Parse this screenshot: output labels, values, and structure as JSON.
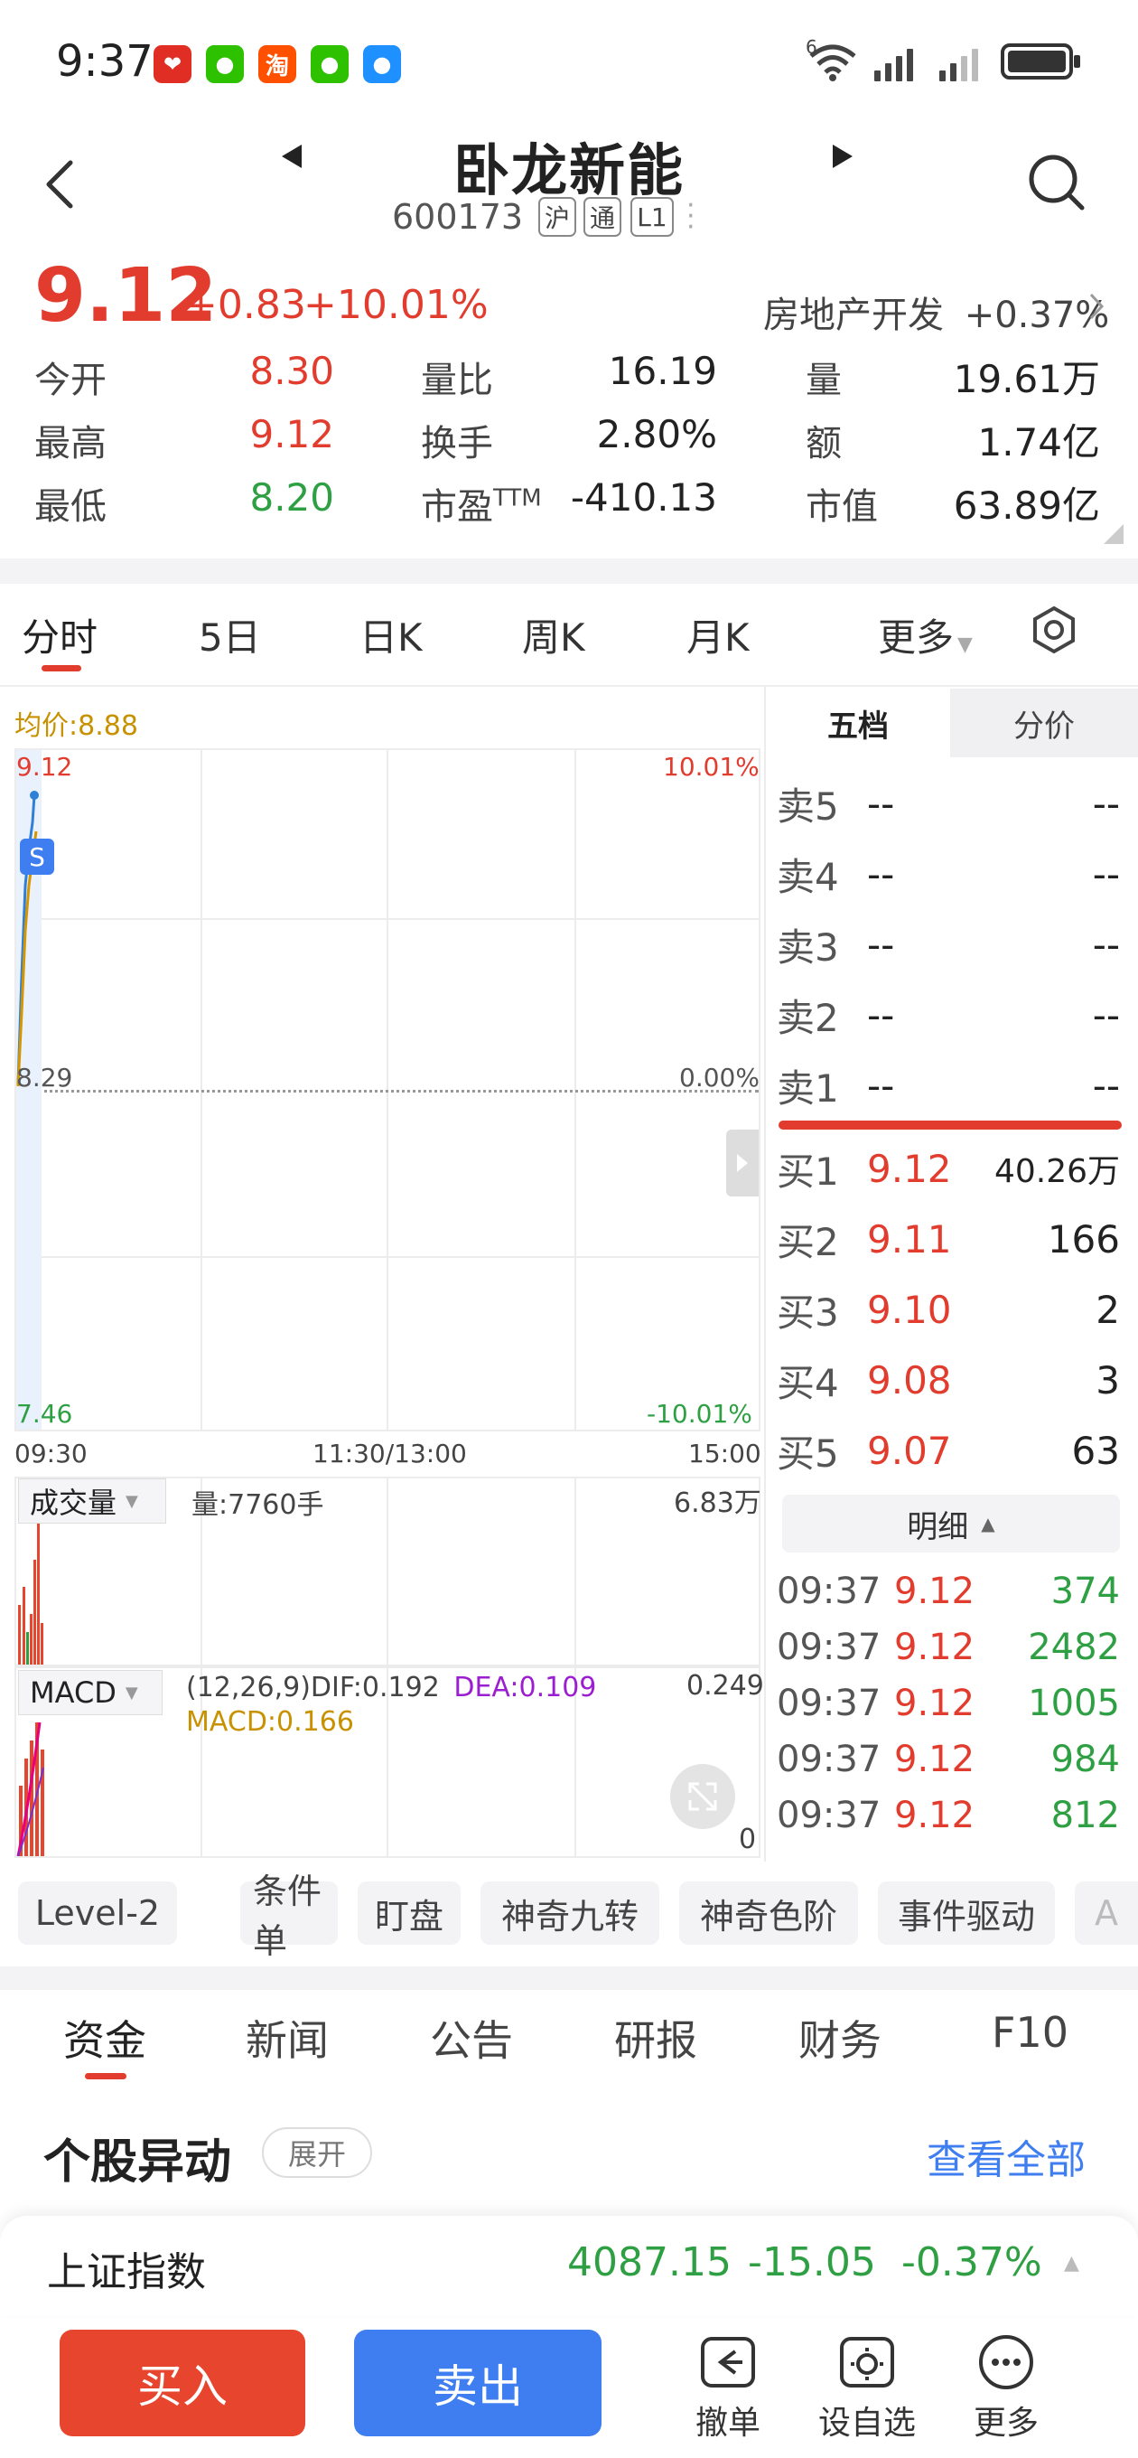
{
  "status_bar": {
    "time": "9:37",
    "apps": [
      {
        "name": "pinduoduo-icon",
        "color": "#e02e24",
        "glyph": "❤"
      },
      {
        "name": "wechat-icon",
        "color": "#2dc100",
        "glyph": "●"
      },
      {
        "name": "taobao-icon",
        "color": "#ff5000",
        "glyph": "淘"
      },
      {
        "name": "wechat-icon-2",
        "color": "#2dc100",
        "glyph": "●"
      },
      {
        "name": "messages-icon",
        "color": "#1e90ff",
        "glyph": "●"
      }
    ],
    "network": "6"
  },
  "header": {
    "title": "卧龙新能",
    "code": "600173",
    "tags": [
      "沪",
      "通",
      "L1"
    ]
  },
  "quote": {
    "price": "9.12",
    "change": "+0.83",
    "change_pct": "+10.01%",
    "sector_name": "房地产开发",
    "sector_pct": "+0.37%",
    "stats": [
      {
        "label": "今开",
        "value": "8.30",
        "color": "red"
      },
      {
        "label": "最高",
        "value": "9.12",
        "color": "red"
      },
      {
        "label": "最低",
        "value": "8.20",
        "color": "green"
      },
      {
        "label": "量比",
        "value": "16.19"
      },
      {
        "label": "换手",
        "value": "2.80%"
      },
      {
        "label": "市盈",
        "sup": "TTM",
        "value": "-410.13"
      },
      {
        "label": "量",
        "value": "19.61万"
      },
      {
        "label": "额",
        "value": "1.74亿"
      },
      {
        "label": "市值",
        "value": "63.89亿"
      }
    ]
  },
  "period_tabs": {
    "items": [
      "分时",
      "5日",
      "日K",
      "周K",
      "月K"
    ],
    "more": "更多",
    "active": "分时"
  },
  "intraday": {
    "avg_label": "均价:8.88",
    "high_price": "9.12",
    "high_pct": "10.01%",
    "mid_price": "8.29",
    "mid_pct": "0.00%",
    "low_price": "7.46",
    "low_pct": "-10.01%",
    "time_start": "09:30",
    "time_mid": "11:30/13:00",
    "time_end": "15:00",
    "signal": "S"
  },
  "volume_panel": {
    "selector": "成交量",
    "value": "量:7760手",
    "max": "6.83万"
  },
  "macd_panel": {
    "selector": "MACD",
    "params": "(12,26,9)",
    "dif": "DIF:0.192",
    "dea": "DEA:0.109",
    "macd": "MACD:0.166",
    "max": "0.249",
    "min": "0"
  },
  "order_book": {
    "tab_active": "五档",
    "tab_other": "分价",
    "asks": [
      {
        "label": "卖5",
        "price": "--",
        "volume": "--"
      },
      {
        "label": "卖4",
        "price": "--",
        "volume": "--"
      },
      {
        "label": "卖3",
        "price": "--",
        "volume": "--"
      },
      {
        "label": "卖2",
        "price": "--",
        "volume": "--"
      },
      {
        "label": "卖1",
        "price": "--",
        "volume": "--"
      }
    ],
    "bids": [
      {
        "label": "买1",
        "price": "9.12",
        "volume": "40.26万"
      },
      {
        "label": "买2",
        "price": "9.11",
        "volume": "166"
      },
      {
        "label": "买3",
        "price": "9.10",
        "volume": "2"
      },
      {
        "label": "买4",
        "price": "9.08",
        "volume": "3"
      },
      {
        "label": "买5",
        "price": "9.07",
        "volume": "63"
      }
    ],
    "detail_label": "明细",
    "ticks": [
      {
        "time": "09:37",
        "price": "9.12",
        "volume": "374"
      },
      {
        "time": "09:37",
        "price": "9.12",
        "volume": "2482"
      },
      {
        "time": "09:37",
        "price": "9.12",
        "volume": "1005"
      },
      {
        "time": "09:37",
        "price": "9.12",
        "volume": "984"
      },
      {
        "time": "09:37",
        "price": "9.12",
        "volume": "812"
      }
    ]
  },
  "feature_chips": [
    "Level-2",
    "条件单",
    "盯盘",
    "神奇九转",
    "神奇色阶",
    "事件驱动",
    "A"
  ],
  "bottom_tabs": {
    "items": [
      "资金",
      "新闻",
      "公告",
      "研报",
      "财务",
      "F10"
    ],
    "active": "资金"
  },
  "movement": {
    "title": "个股异动",
    "expand": "展开",
    "view_all": "查看全部"
  },
  "index_ticker": {
    "name": "上证指数",
    "value": "4087.15",
    "change": "-15.05",
    "pct": "-0.37%"
  },
  "actions": {
    "buy": "买入",
    "sell": "卖出",
    "cancel": "撤单",
    "watchlist": "设自选",
    "more": "更多"
  },
  "colors": {
    "up": "#e23c2e",
    "down": "#2ea043",
    "buy": "#e8452f",
    "sell": "#3f7ef0",
    "link": "#3f7ef0"
  }
}
